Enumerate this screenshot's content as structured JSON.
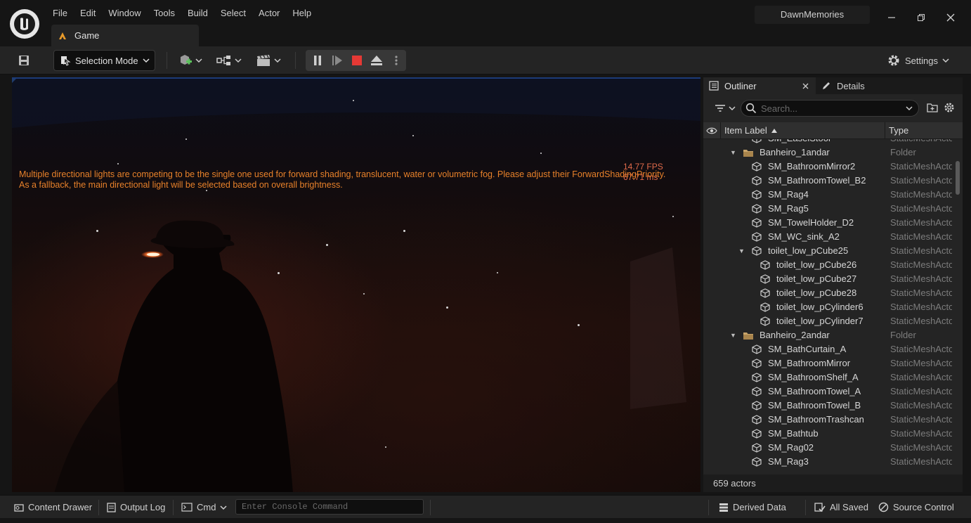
{
  "window": {
    "project_name": "DawnMemories",
    "menu": [
      "File",
      "Edit",
      "Window",
      "Tools",
      "Build",
      "Select",
      "Actor",
      "Help"
    ],
    "tab_label": "Game"
  },
  "toolbar": {
    "selection_mode_label": "Selection Mode",
    "settings_label": "Settings"
  },
  "viewport": {
    "warning_line1": "Multiple directional lights are competing to be the single one used for forward shading, translucent, water or volumetric fog. Please adjust their ForwardShadingPriority.",
    "warning_line2": "As a fallback, the main directional light will be selected based on overall brightness.",
    "fps": "14.77 FPS",
    "ms": "67.71 ms"
  },
  "outliner": {
    "tab_outliner": "Outliner",
    "tab_details": "Details",
    "search_placeholder": "Search...",
    "col_item_label": "Item Label",
    "col_type": "Type",
    "rows": [
      {
        "label": "SM_EaselStool",
        "type": "StaticMeshActor",
        "depth": 2,
        "kind": "mesh"
      },
      {
        "label": "Banheiro_1andar",
        "type": "Folder",
        "depth": 1,
        "kind": "folder",
        "expanded": true
      },
      {
        "label": "SM_BathroomMirror2",
        "type": "StaticMeshActor",
        "depth": 2,
        "kind": "mesh"
      },
      {
        "label": "SM_BathroomTowel_B2",
        "type": "StaticMeshActor",
        "depth": 2,
        "kind": "mesh"
      },
      {
        "label": "SM_Rag4",
        "type": "StaticMeshActor",
        "depth": 2,
        "kind": "mesh"
      },
      {
        "label": "SM_Rag5",
        "type": "StaticMeshActor",
        "depth": 2,
        "kind": "mesh"
      },
      {
        "label": "SM_TowelHolder_D2",
        "type": "StaticMeshActor",
        "depth": 2,
        "kind": "mesh"
      },
      {
        "label": "SM_WC_sink_A2",
        "type": "StaticMeshActor",
        "depth": 2,
        "kind": "mesh"
      },
      {
        "label": "toilet_low_pCube25",
        "type": "StaticMeshActor",
        "depth": 2,
        "kind": "mesh",
        "expanded": true
      },
      {
        "label": "toilet_low_pCube26",
        "type": "StaticMeshActor",
        "depth": 3,
        "kind": "mesh"
      },
      {
        "label": "toilet_low_pCube27",
        "type": "StaticMeshActor",
        "depth": 3,
        "kind": "mesh"
      },
      {
        "label": "toilet_low_pCube28",
        "type": "StaticMeshActor",
        "depth": 3,
        "kind": "mesh"
      },
      {
        "label": "toilet_low_pCylinder6",
        "type": "StaticMeshActor",
        "depth": 3,
        "kind": "mesh"
      },
      {
        "label": "toilet_low_pCylinder7",
        "type": "StaticMeshActor",
        "depth": 3,
        "kind": "mesh"
      },
      {
        "label": "Banheiro_2andar",
        "type": "Folder",
        "depth": 1,
        "kind": "folder",
        "expanded": true
      },
      {
        "label": "SM_BathCurtain_A",
        "type": "StaticMeshActor",
        "depth": 2,
        "kind": "mesh"
      },
      {
        "label": "SM_BathroomMirror",
        "type": "StaticMeshActor",
        "depth": 2,
        "kind": "mesh"
      },
      {
        "label": "SM_BathroomShelf_A",
        "type": "StaticMeshActor",
        "depth": 2,
        "kind": "mesh"
      },
      {
        "label": "SM_BathroomTowel_A",
        "type": "StaticMeshActor",
        "depth": 2,
        "kind": "mesh"
      },
      {
        "label": "SM_BathroomTowel_B",
        "type": "StaticMeshActor",
        "depth": 2,
        "kind": "mesh"
      },
      {
        "label": "SM_BathroomTrashcan",
        "type": "StaticMeshActor",
        "depth": 2,
        "kind": "mesh"
      },
      {
        "label": "SM_Bathtub",
        "type": "StaticMeshActor",
        "depth": 2,
        "kind": "mesh"
      },
      {
        "label": "SM_Rag02",
        "type": "StaticMeshActor",
        "depth": 2,
        "kind": "mesh"
      },
      {
        "label": "SM_Rag3",
        "type": "StaticMeshActor",
        "depth": 2,
        "kind": "mesh"
      }
    ],
    "actor_count": "659 actors"
  },
  "statusbar": {
    "content_drawer": "Content Drawer",
    "output_log": "Output Log",
    "cmd": "Cmd",
    "console_placeholder": "Enter Console Command",
    "derived_data": "Derived Data",
    "all_saved": "All Saved",
    "source_control": "Source Control"
  },
  "colors": {
    "warning": "#e8812a",
    "fps": "#e06a4a",
    "stop": "#e53935",
    "folder": "#c8a46a"
  }
}
